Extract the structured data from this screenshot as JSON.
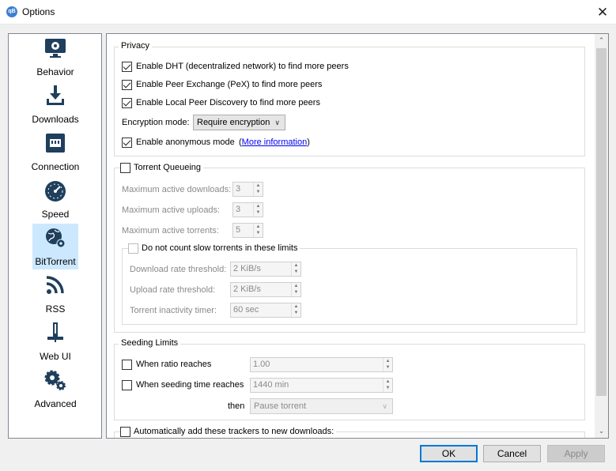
{
  "window": {
    "title": "Options",
    "app_icon": "qB",
    "close_glyph": "✕"
  },
  "sidebar": {
    "items": [
      {
        "label": "Behavior",
        "icon": "monitor-gear-icon"
      },
      {
        "label": "Downloads",
        "icon": "download-tray-icon"
      },
      {
        "label": "Connection",
        "icon": "network-port-icon"
      },
      {
        "label": "Speed",
        "icon": "speedometer-icon"
      },
      {
        "label": "BitTorrent",
        "icon": "globe-gear-icon",
        "selected": true
      },
      {
        "label": "RSS",
        "icon": "rss-feed-icon"
      },
      {
        "label": "Web UI",
        "icon": "web-ui-icon"
      },
      {
        "label": "Advanced",
        "icon": "gears-icon"
      }
    ]
  },
  "privacy": {
    "title": "Privacy",
    "dht": {
      "label": "Enable DHT (decentralized network) to find more peers",
      "checked": true
    },
    "pex": {
      "label": "Enable Peer Exchange (PeX) to find more peers",
      "checked": true
    },
    "lpd": {
      "label": "Enable Local Peer Discovery to find more peers",
      "checked": true
    },
    "encryption_label": "Encryption mode:",
    "encryption_value": "Require encryption",
    "anonymous": {
      "label": "Enable anonymous mode",
      "checked": true
    },
    "more_info_open": "(",
    "more_info_link": "More information",
    "more_info_close": ")"
  },
  "queueing": {
    "title": "Torrent Queueing",
    "checked": false,
    "max_downloads_label": "Maximum active downloads:",
    "max_downloads_value": "3",
    "max_uploads_label": "Maximum active uploads:",
    "max_uploads_value": "3",
    "max_torrents_label": "Maximum active torrents:",
    "max_torrents_value": "5",
    "slow": {
      "label": "Do not count slow torrents in these limits",
      "checked": false,
      "download_label": "Download rate threshold:",
      "download_value": "2 KiB/s",
      "upload_label": "Upload rate threshold:",
      "upload_value": "2 KiB/s",
      "inactivity_label": "Torrent inactivity timer:",
      "inactivity_value": "60 sec"
    }
  },
  "seeding": {
    "title": "Seeding Limits",
    "ratio_label": "When ratio reaches",
    "ratio_value": "1.00",
    "time_label": "When seeding time reaches",
    "time_value": "1440 min",
    "then_label": "then",
    "then_value": "Pause torrent"
  },
  "trackers": {
    "label": "Automatically add these trackers to new downloads:",
    "checked": false
  },
  "buttons": {
    "ok": "OK",
    "cancel": "Cancel",
    "apply": "Apply"
  },
  "colors": {
    "accent": "#0078d7",
    "selection": "#cce8ff",
    "link": "#0000ee"
  }
}
